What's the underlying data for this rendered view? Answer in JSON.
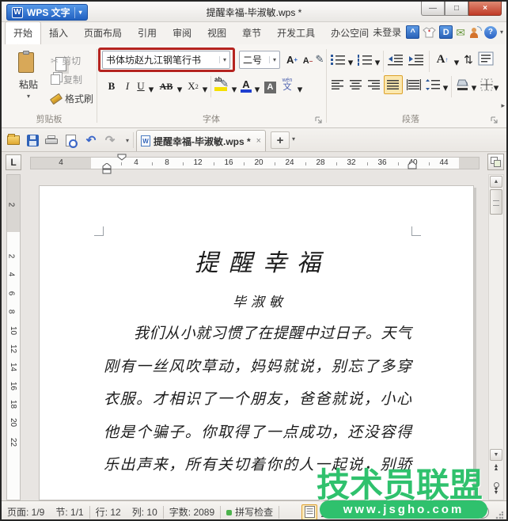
{
  "titlebar": {
    "app_button": "WPS 文字",
    "title": "提醒幸福-毕淑敏.wps *"
  },
  "ribbon_tabs": {
    "items": [
      "开始",
      "插入",
      "页面布局",
      "引用",
      "审阅",
      "视图",
      "章节",
      "开发工具",
      "办公空间"
    ],
    "active": "开始",
    "login": "未登录"
  },
  "ribbon": {
    "clipboard": {
      "label": "剪贴板",
      "paste": "粘贴",
      "cut": "剪切",
      "copy": "复制",
      "format_painter": "格式刷"
    },
    "font": {
      "label": "字体",
      "name": "书体坊赵九江钢笔行书",
      "size": "二号",
      "bold": "B",
      "italic": "I",
      "underline": "U",
      "strike": "AB",
      "sup_base": "X",
      "sup_exp": "2",
      "highlight_label": "ab",
      "color_label": "A",
      "shading_label": "A",
      "pinyin_ruby": "wén",
      "pinyin_base": "文",
      "grow": "A",
      "shrink": "A"
    },
    "paragraph": {
      "label": "段落"
    }
  },
  "doc_tab": {
    "title": "提醒幸福-毕淑敏.wps *"
  },
  "ruler": {
    "h_gray": "4",
    "h": [
      "4",
      "8",
      "12",
      "16",
      "20",
      "24",
      "28",
      "32",
      "36",
      "40",
      "44"
    ],
    "v_gray": "2",
    "v": [
      "2",
      "4",
      "6",
      "8",
      "10",
      "12",
      "14",
      "16",
      "18",
      "20",
      "22"
    ]
  },
  "document": {
    "title": "提醒幸福",
    "author": "毕淑敏",
    "lines": [
      "我们从小就习惯了在提醒中过日子。天气",
      "刚有一丝风吹草动，妈妈就说，别忘了多穿",
      "衣服。才相识了一个朋友，爸爸就说，小心",
      "他是个骗子。你取得了一点成功，还没容得",
      "乐出声来，所有关切着你的人一起说，别骄"
    ]
  },
  "statusbar": {
    "page": "页面: 1/9",
    "section": "节: 1/1",
    "line": "行: 12",
    "column": "列: 10",
    "words": "字数: 2089",
    "spellcheck": "拼写检查"
  },
  "watermark": {
    "title": "技术员联盟",
    "url": "www.jsgho.com",
    "color": "#2fc16d"
  },
  "icons": {
    "caret": "▾",
    "minimize": "—",
    "maximize": "□",
    "close": "×",
    "tab_close": "×",
    "scissors": "✂",
    "undo": "↶",
    "redo": "↷",
    "up": "▲",
    "down": "▼",
    "right": "▸",
    "plus": "+",
    "help": "?",
    "hat": "^",
    "docer": "D",
    "w_logo": "W",
    "tab_stop": "L",
    "envelope": "✉",
    "pen": "✎",
    "wrap": "⇅",
    "doc_w": "W"
  },
  "colors": {
    "annotation_red": "#b5231f",
    "selection_orange": "#dda22b",
    "watermark_green": "#2fc16d",
    "wps_blue": "#2a6bd2"
  }
}
